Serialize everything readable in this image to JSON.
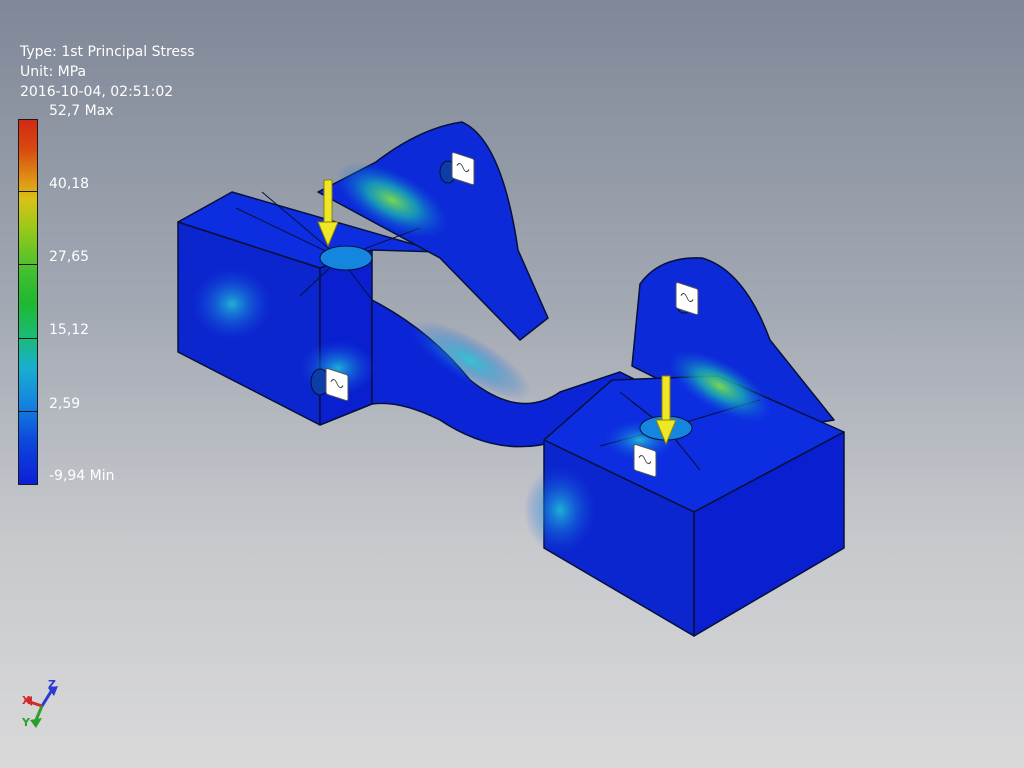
{
  "result_info": {
    "type_line": "Type: 1st Principal Stress",
    "unit_line": "Unit: MPa",
    "timestamp_line": "2016-10-04, 02:51:02"
  },
  "color_scale": {
    "labels": [
      "52,7 Max",
      "40,18",
      "27,65",
      "15,12",
      "2,59",
      "-9,94 Min"
    ],
    "values": [
      52.7,
      40.18,
      27.65,
      15.12,
      2.59,
      -9.94
    ],
    "colors": [
      "#d02a14",
      "#e0a014",
      "#98c81a",
      "#20b830",
      "#19aed0",
      "#0b1ed8"
    ]
  },
  "view_triad": {
    "x_label": "X",
    "y_label": "Y",
    "z_label": "Z",
    "x_color": "#d22a2a",
    "y_color": "#2aa02a",
    "z_color": "#2a3ad2"
  },
  "model": {
    "base_color": "#0a22d8",
    "load_arrow_color": "#f0e628",
    "constraint_icon": "fixed-constraint-icon"
  }
}
